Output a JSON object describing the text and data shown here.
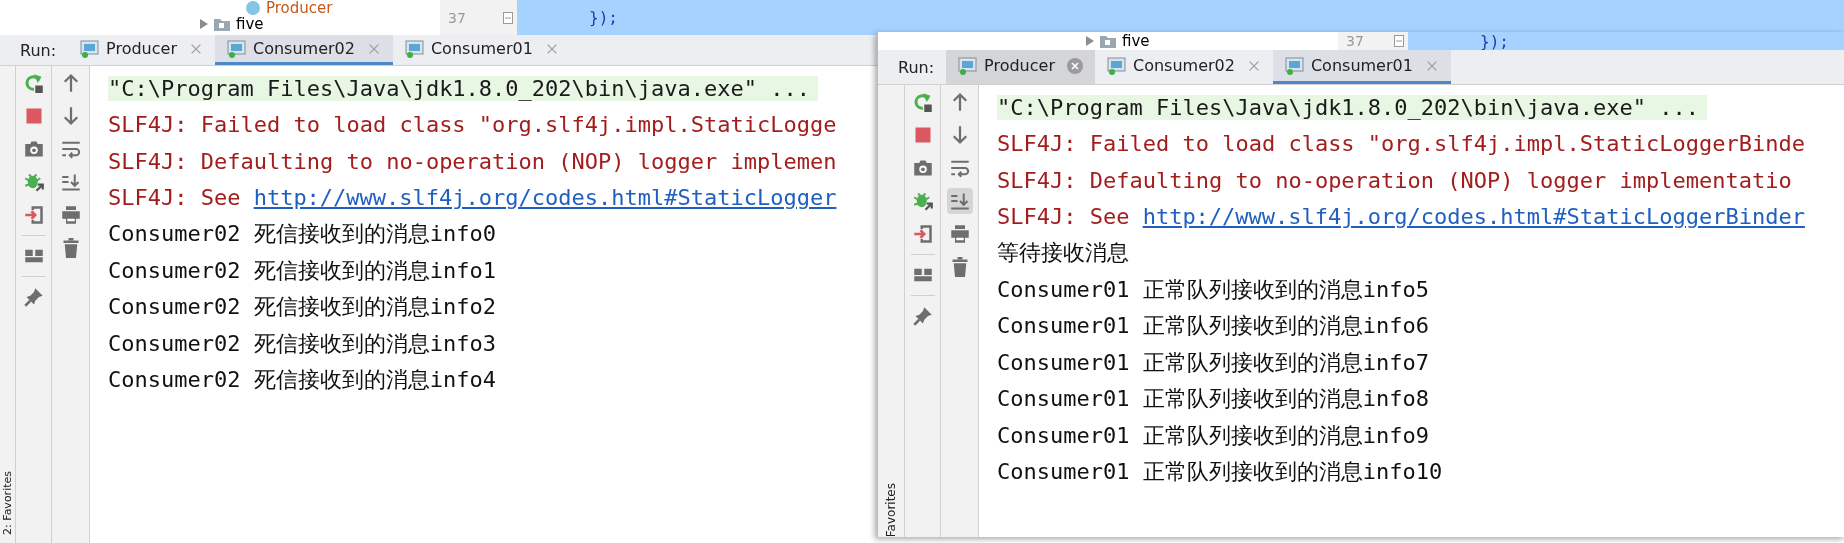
{
  "windows": [
    {
      "editor_strip": {
        "tree_items": [
          {
            "label": "Producer",
            "kind": "class"
          },
          {
            "label": "five",
            "kind": "folder"
          }
        ],
        "line_number": "37",
        "code": "});"
      },
      "run_label": "Run:",
      "tabs": [
        {
          "label": "Producer",
          "selected": false,
          "close_hovered": false
        },
        {
          "label": "Consumer02",
          "selected": true,
          "close_hovered": false
        },
        {
          "label": "Consumer01",
          "selected": false,
          "close_hovered": false
        }
      ],
      "toolbar": {
        "scroll_to_end_on": false
      },
      "favorites_label": "2: Favorites",
      "console": [
        {
          "kind": "command",
          "text": "\"C:\\Program Files\\Java\\jdk1.8.0_202\\bin\\java.exe\" ..."
        },
        {
          "kind": "error",
          "text": "SLF4J: Failed to load class \"org.slf4j.impl.StaticLogge"
        },
        {
          "kind": "error",
          "text": "SLF4J: Defaulting to no-operation (NOP) logger implemen"
        },
        {
          "kind": "link",
          "text": "SLF4J: See",
          "link": "http://www.slf4j.org/codes.html#StaticLogger"
        },
        {
          "kind": "output",
          "text": "Consumer02 死信接收到的消息info0"
        },
        {
          "kind": "output",
          "text": "Consumer02 死信接收到的消息info1"
        },
        {
          "kind": "output",
          "text": "Consumer02 死信接收到的消息info2"
        },
        {
          "kind": "output",
          "text": "Consumer02 死信接收到的消息info3"
        },
        {
          "kind": "output",
          "text": "Consumer02 死信接收到的消息info4"
        }
      ]
    },
    {
      "editor_strip": {
        "tree_items": [
          {
            "label": "five",
            "kind": "folder"
          }
        ],
        "line_number": "37",
        "code": "});"
      },
      "run_label": "Run:",
      "tabs": [
        {
          "label": "Producer",
          "selected": false,
          "close_hovered": true
        },
        {
          "label": "Consumer02",
          "selected": false,
          "close_hovered": false
        },
        {
          "label": "Consumer01",
          "selected": true,
          "close_hovered": false
        }
      ],
      "toolbar": {
        "scroll_to_end_on": true
      },
      "favorites_label": "Favorites",
      "console": [
        {
          "kind": "command",
          "text": "\"C:\\Program Files\\Java\\jdk1.8.0_202\\bin\\java.exe\" ..."
        },
        {
          "kind": "error",
          "text": "SLF4J: Failed to load class \"org.slf4j.impl.StaticLoggerBinde"
        },
        {
          "kind": "error",
          "text": "SLF4J: Defaulting to no-operation (NOP) logger implementatio"
        },
        {
          "kind": "link",
          "text": "SLF4J: See",
          "link": "http://www.slf4j.org/codes.html#StaticLoggerBinder"
        },
        {
          "kind": "output",
          "text": "等待接收消息"
        },
        {
          "kind": "output",
          "text": "Consumer01 正常队列接收到的消息info5"
        },
        {
          "kind": "output",
          "text": "Consumer01 正常队列接收到的消息info6"
        },
        {
          "kind": "output",
          "text": "Consumer01 正常队列接收到的消息info7"
        },
        {
          "kind": "output",
          "text": "Consumer01 正常队列接收到的消息info8"
        },
        {
          "kind": "output",
          "text": "Consumer01 正常队列接收到的消息info9"
        },
        {
          "kind": "output",
          "text": "Consumer01 正常队列接收到的消息info10"
        }
      ]
    }
  ]
}
